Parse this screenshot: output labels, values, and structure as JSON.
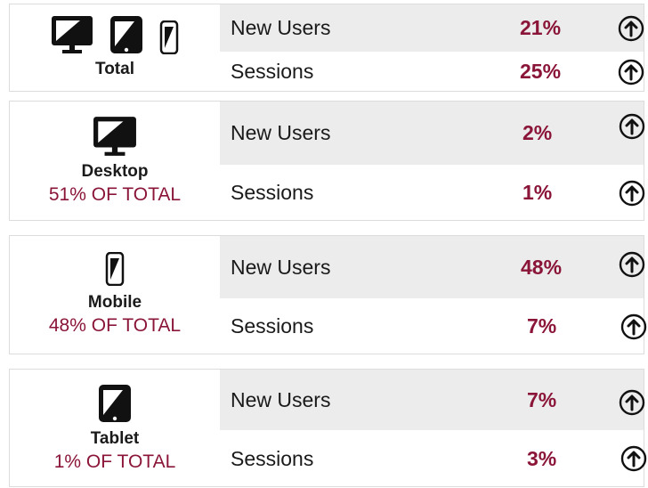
{
  "colors": {
    "accent": "#8a1538",
    "row_shade": "#ececec",
    "text": "#1a1a1a"
  },
  "metric_labels": {
    "new_users": "New Users",
    "sessions": "Sessions"
  },
  "total": {
    "label": "Total",
    "icons": [
      "desktop-icon",
      "tablet-icon",
      "mobile-icon"
    ],
    "new_users": "21%",
    "sessions": "25%",
    "trend_icon": "arrow-up-circle-icon"
  },
  "desktop": {
    "label": "Desktop",
    "share": "51% OF TOTAL",
    "icon": "desktop-icon",
    "new_users": "2%",
    "sessions": "1%"
  },
  "mobile": {
    "label": "Mobile",
    "share": "48% OF TOTAL",
    "icon": "mobile-icon",
    "new_users": "48%",
    "sessions": "7%"
  },
  "tablet": {
    "label": "Tablet",
    "share": "1% OF TOTAL",
    "icon": "tablet-icon",
    "new_users": "7%",
    "sessions": "3%"
  }
}
